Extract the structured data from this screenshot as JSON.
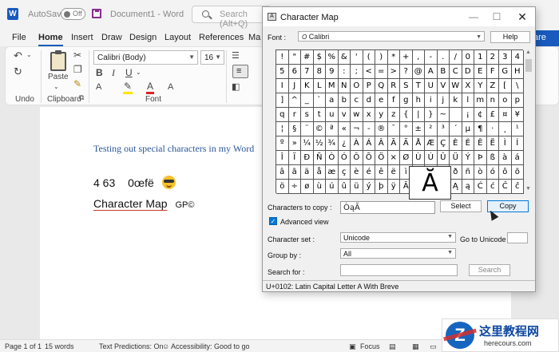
{
  "word": {
    "autosave_label": "AutoSave",
    "autosave_state": "Off",
    "document_title": "Document1 - Word",
    "search_placeholder": "Search (Alt+Q)",
    "tabs": [
      "File",
      "Home",
      "Insert",
      "Draw",
      "Design",
      "Layout",
      "References",
      "Mailings"
    ],
    "share_label": "are",
    "ribbon": {
      "paste_label": "Paste",
      "font_name": "Calibri (Body)",
      "font_size": "16",
      "bold": "B",
      "italic": "I",
      "underline": "U",
      "groups": [
        "Undo",
        "Clipboard",
        "Font"
      ]
    },
    "document": {
      "line1": "Testing out special characters in my Word",
      "line2_numbers": "4 63",
      "line2_chars": "0œfë",
      "line3_main": "Character Map",
      "line3_small": "GP©"
    },
    "status": {
      "page": "Page 1 of 1",
      "words": "15 words",
      "predictions": "Text Predictions: On",
      "accessibility": "Accessibility: Good to go",
      "focus": "Focus"
    }
  },
  "charmap": {
    "title": "Character Map",
    "font_label": "Font :",
    "font_value": "Calibri",
    "help_button": "Help",
    "grid_rows": [
      [
        "!",
        "\"",
        "#",
        "$",
        "%",
        "&",
        "'",
        "(",
        ")",
        "*",
        "+",
        ",",
        "-",
        ".",
        "/",
        "0",
        "1",
        "2",
        "3",
        "4"
      ],
      [
        "5",
        "6",
        "7",
        "8",
        "9",
        ":",
        ";",
        "<",
        "=",
        ">",
        "?",
        "@",
        "A",
        "B",
        "C",
        "D",
        "E",
        "F",
        "G",
        "H"
      ],
      [
        "I",
        "J",
        "K",
        "L",
        "M",
        "N",
        "O",
        "P",
        "Q",
        "R",
        "S",
        "T",
        "U",
        "V",
        "W",
        "X",
        "Y",
        "Z",
        "[",
        "\\"
      ],
      [
        "]",
        "^",
        "_",
        "`",
        "a",
        "b",
        "c",
        "d",
        "e",
        "f",
        "g",
        "h",
        "i",
        "j",
        "k",
        "l",
        "m",
        "n",
        "o",
        "p"
      ],
      [
        "q",
        "r",
        "s",
        "t",
        "u",
        "v",
        "w",
        "x",
        "y",
        "z",
        "{",
        "|",
        "}",
        "~",
        " ",
        "¡",
        "¢",
        "£",
        "¤",
        "¥"
      ],
      [
        "¦",
        "§",
        "¨",
        "©",
        "ª",
        "«",
        "¬",
        "-",
        "®",
        "¯",
        "°",
        "±",
        "²",
        "³",
        "´",
        "µ",
        "¶",
        "·",
        "¸",
        "¹"
      ],
      [
        "º",
        "»",
        "¼",
        "½",
        "¾",
        "¿",
        "À",
        "Á",
        "Â",
        "Ã",
        "Ä",
        "Å",
        "Æ",
        "Ç",
        "È",
        "É",
        "Ê",
        "Ë",
        "Ì",
        "Í"
      ],
      [
        "Î",
        "Ï",
        "Ð",
        "Ñ",
        "Ò",
        "Ó",
        "Ô",
        "Õ",
        "Ö",
        "×",
        "Ø",
        "Ù",
        "Ú",
        "Û",
        "Ü",
        "Ý",
        "Þ",
        "ß",
        "à",
        "á"
      ],
      [
        "â",
        "ã",
        "ä",
        "å",
        "æ",
        "ç",
        "è",
        "é",
        "ê",
        "ë",
        "ì",
        "í",
        "î",
        "ï",
        "ð",
        "ñ",
        "ò",
        "ó",
        "ô",
        "õ"
      ],
      [
        "ö",
        "÷",
        "ø",
        "ù",
        "ú",
        "û",
        "ü",
        "ý",
        "þ",
        "ÿ",
        "Ā",
        "ā",
        "Ă",
        "ă",
        "Ą",
        "ą",
        "Ć",
        "ć",
        "Ĉ",
        "ĉ"
      ]
    ],
    "zoom_char": "Ă",
    "copy_label": "Characters to copy :",
    "copy_value": "ÒąĂ",
    "select_button": "Select",
    "copy_button": "Copy",
    "advanced_label": "Advanced view",
    "charset_label": "Character set :",
    "charset_value": "Unicode",
    "goto_label": "Go to Unicode :",
    "groupby_label": "Group by :",
    "groupby_value": "All",
    "searchfor_label": "Search for :",
    "search_button": "Search",
    "status": "U+0102: Latin Capital Letter A With Breve"
  },
  "watermark": {
    "logo_letter": "Z",
    "title": "这里教程网",
    "url": "herecours.com"
  }
}
